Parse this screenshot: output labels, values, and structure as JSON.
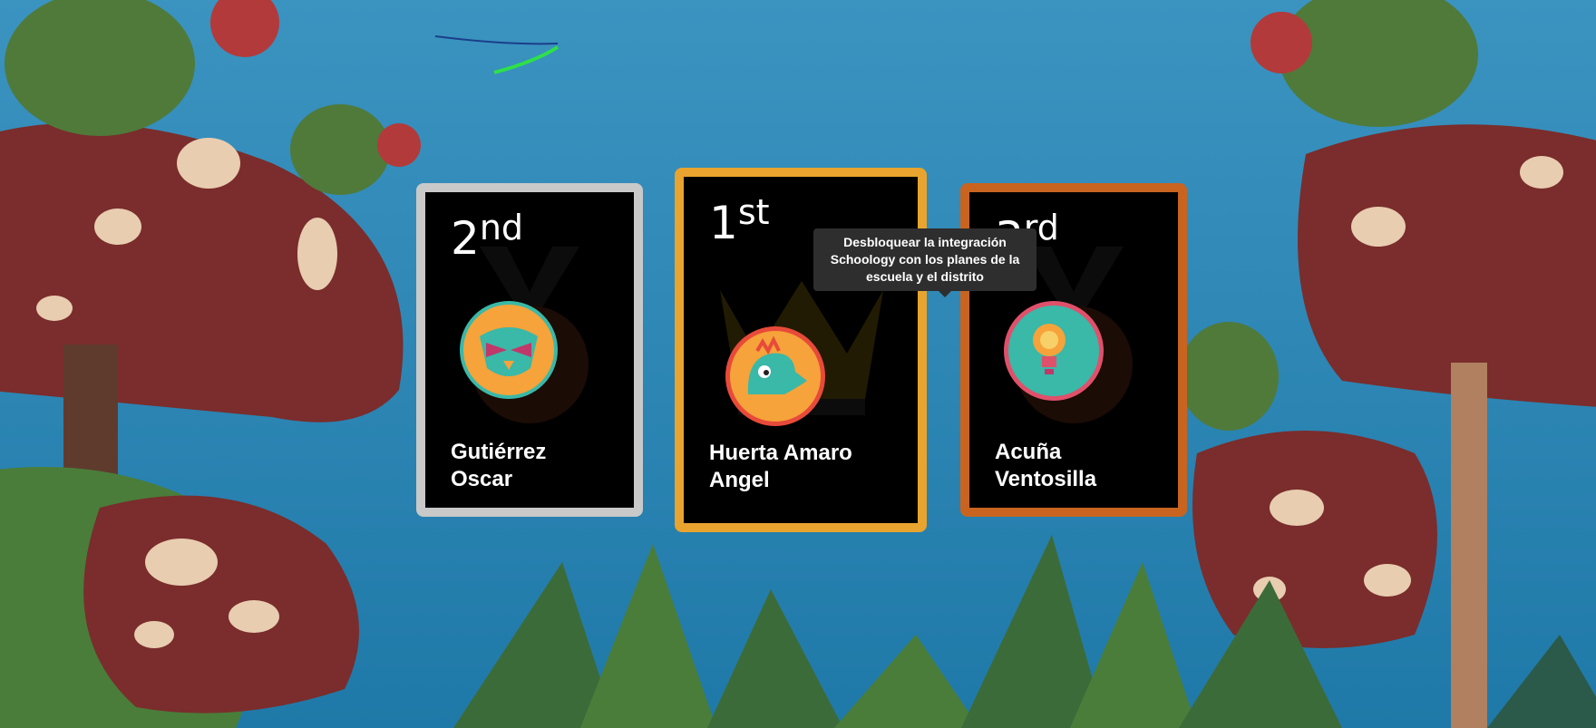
{
  "podium": [
    {
      "rank_num": "2",
      "rank_suffix": "nd",
      "name": "Gutiérrez Oscar",
      "medal": "silver",
      "avatar": "owl-mask-avatar-icon"
    },
    {
      "rank_num": "1",
      "rank_suffix": "st",
      "name": "Huerta Amaro Angel",
      "medal": "gold",
      "avatar": "dinosaur-avatar-icon"
    },
    {
      "rank_num": "3",
      "rank_suffix": "rd",
      "name": "Acuña Ventosilla",
      "medal": "bronze",
      "avatar": "lightbulb-avatar-icon"
    }
  ],
  "tooltip": {
    "text": "Desbloquear la integración Schoology con los planes de la escuela y el distrito"
  },
  "colors": {
    "silver": "#c9c9c9",
    "gold": "#e8a42e",
    "bronze": "#c8641f",
    "sky": "#2f86b3"
  }
}
